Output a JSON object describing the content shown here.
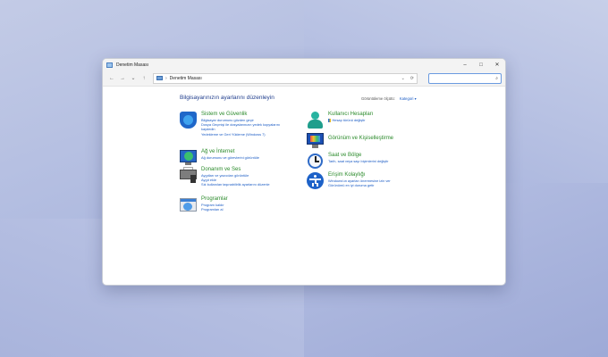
{
  "window": {
    "title": "Denetim Masası",
    "controls": {
      "minimize": "–",
      "maximize": "□",
      "close": "✕"
    }
  },
  "nav": {
    "back": "←",
    "forward": "→",
    "recent": "⌄",
    "up": "↑",
    "address_separator": "›",
    "address_path": "Denetim Masası",
    "address_dropdown": "⌄",
    "refresh": "⟳",
    "search_placeholder": "",
    "search_icon": "⌕"
  },
  "content": {
    "heading": "Bilgisayarınızın ayarlarını düzenleyin",
    "view_by_label": "Görüntüleme ölçütü:",
    "view_by_value": "Kategori ▾"
  },
  "categories_left": [
    {
      "title": "Sistem ve Güvenlik",
      "icon": "shield-icon",
      "links": [
        "Bilgisayar durumunu gözden geçir",
        "Dosya Geçmişi ile dosyalarınızın yedek kopyalarını",
        "kaydedin",
        "Yedekleme ve Geri Yükleme (Windows 7)"
      ]
    },
    {
      "title": "Ağ ve İnternet",
      "icon": "network-icon",
      "links": [
        "Ağ durumunu ve görevlerini görüntüle"
      ]
    },
    {
      "title": "Donanım ve Ses",
      "icon": "printer-icon",
      "links": [
        "Aygıtları ve yazıcıları görüntüle",
        "Aygıt ekle",
        "Sık kullanılan taşınabilirlik ayarlarını düzenle"
      ]
    },
    {
      "title": "Programlar",
      "icon": "programs-icon",
      "links": [
        "Program kaldır",
        "Programları al"
      ]
    }
  ],
  "categories_right": [
    {
      "title": "Kullanıcı Hesapları",
      "icon": "user-icon",
      "links": [
        "Hesap türünü değiştir"
      ]
    },
    {
      "title": "Görünüm ve Kişiselleştirme",
      "icon": "appearance-icon",
      "links": []
    },
    {
      "title": "Saat ve Bölge",
      "icon": "clock-icon",
      "links": [
        "Tarih, saat veya sayı biçimlerini değiştir"
      ]
    },
    {
      "title": "Erişim Kolaylığı",
      "icon": "accessibility-icon",
      "links": [
        "Windows'un ayarları önermesine izin ver",
        "Görünümü en iyi duruma getir"
      ]
    }
  ],
  "colors": {
    "heading": "#1e3c8c",
    "category_title": "#2a8a2a",
    "link": "#1a5bc4"
  }
}
